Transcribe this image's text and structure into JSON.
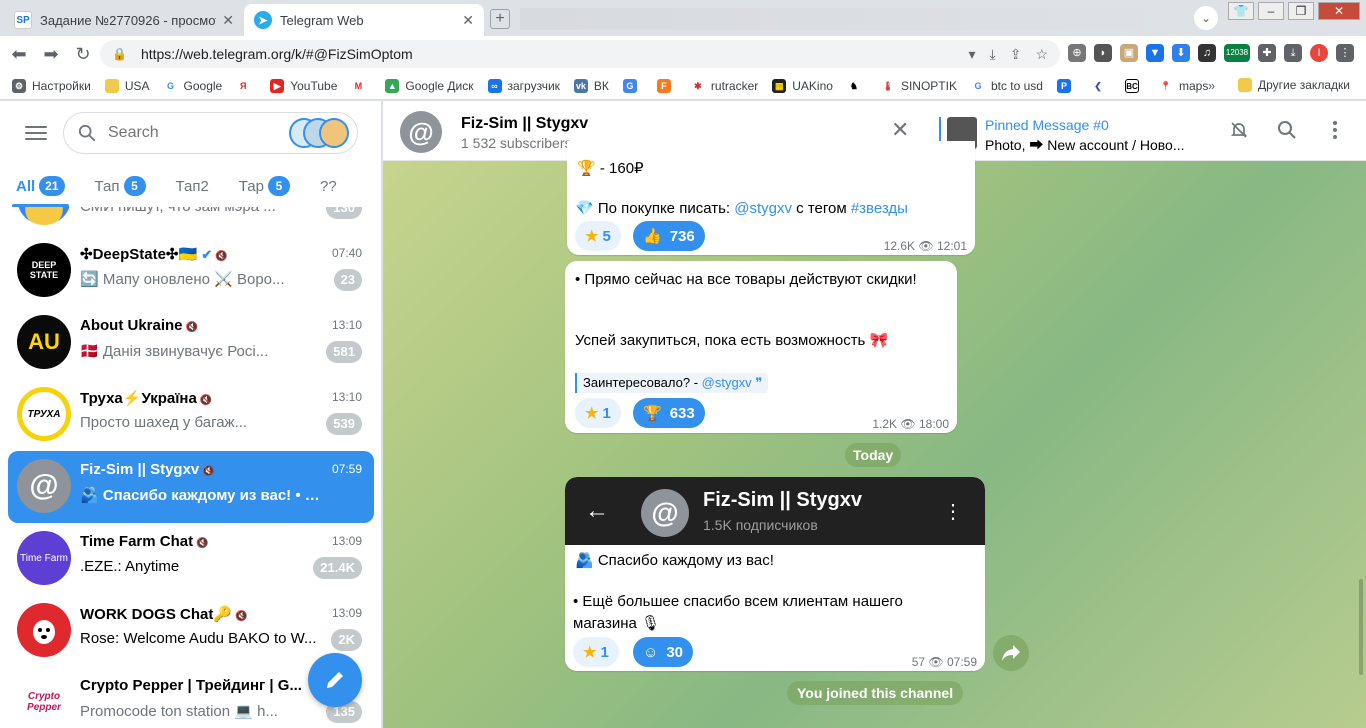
{
  "browser": {
    "tabs": [
      {
        "icon_text": "SP",
        "title": "Задание №2770926 - просмотр з"
      },
      {
        "icon_text": "",
        "title": "Telegram Web"
      }
    ],
    "url": "https://web.telegram.org/k/#@FizSimOptom",
    "ext_badge": "12038",
    "bookmarks": [
      "Настройки",
      "USA",
      "Google",
      "",
      "YouTube",
      "",
      "Google Диск",
      "загрузчик",
      "ВК",
      "",
      "",
      "rutracker",
      "UAKino",
      "",
      "SINOPTIK",
      "btc to usd",
      "",
      "",
      "",
      "maps"
    ],
    "bookmarks_more": "»",
    "other_bookmarks": "Другие закладки"
  },
  "sidebar": {
    "search_placeholder": "Search",
    "folders": [
      {
        "label": "All",
        "badge": "21"
      },
      {
        "label": "Тап",
        "badge": "5"
      },
      {
        "label": "Тап2",
        "badge": ""
      },
      {
        "label": "Тар",
        "badge": "5"
      },
      {
        "label": "??",
        "badge": ""
      }
    ],
    "partial_top_msg": "СМИ пишут, что зам мэра ...",
    "partial_top_badge": "130",
    "chats": [
      {
        "title": "✣DeepState✣🇺🇦",
        "time": "07:40",
        "msg": "🔄 Мапу оновлено ⚔️ Воро...",
        "badge": "23",
        "avatar": "DEEP STATE"
      },
      {
        "title": "About Ukraine",
        "time": "13:10",
        "msg": "🇩🇰 Данія звинувачує Росі...",
        "badge": "581",
        "avatar": "AU"
      },
      {
        "title": "Труха⚡Україна",
        "time": "13:10",
        "msg": "Просто шахед у багаж...",
        "badge": "539",
        "avatar": "ТРУХА"
      },
      {
        "title": "Fiz-Sim || Stygxv",
        "time": "07:59",
        "msg": "🫂 Спасибо каждому из вас! • Е...",
        "badge": "",
        "avatar": "@"
      },
      {
        "title": "Time Farm Chat",
        "time": "13:09",
        "msg": ".EZE.: Anytime",
        "badge": "21.4K",
        "avatar": "Time Farm"
      },
      {
        "title": "WORK DOGS Chat🔑",
        "time": "13:09",
        "msg": "Rose: Welcome Audu BAKO to W...",
        "badge": "2K",
        "avatar": ""
      },
      {
        "title": "Crypto Pepper | Трейдинг | G...",
        "time": "",
        "msg": "Promocode ton station 💻 h...",
        "badge": "135",
        "avatar": "Crypto Pepper"
      }
    ]
  },
  "chat": {
    "title": "Fiz-Sim || Stygxv",
    "subscribers": "1 532 subscribers",
    "pinned_title": "Pinned Message #0",
    "pinned_text": "Photo, ⮕ New account / Ново...",
    "msg1": {
      "top_line": "🏆 - 160₽",
      "line_prefix": "💎 По покупке писать: ",
      "line_handle": "@stygxv",
      "line_mid": " с тегом ",
      "line_tag": "#звезды",
      "star_count": "5",
      "reaction_count": "736",
      "views": "12.6K",
      "time": "12:01"
    },
    "msg2": {
      "line1": "• Прямо сейчас на все товары действуют скидки!",
      "line2": "Успей закупиться, пока есть возможность 🎀",
      "quote_prefix": "Заинтересовало? - ",
      "quote_handle": "@stygxv",
      "star_count": "1",
      "reaction_count": "633",
      "views": "1.2K",
      "time": "18:00"
    },
    "date_divider": "Today",
    "msg3": {
      "shot_title": "Fiz-Sim || Stygxv",
      "shot_sub": "1.5K подписчиков",
      "line1": "🫂 Спасибо каждому из вас!",
      "line2": "• Ещё большее спасибо всем клиентам нашего",
      "line3": "магазина 🎙",
      "star_count": "1",
      "reaction_count": "30",
      "views": "57",
      "time": "07:59"
    },
    "joined_notice": "You joined this channel"
  },
  "colors": {
    "accent": "#3390ec",
    "active_chat_bg": "#3390ec",
    "chat_bg": "#a7c582"
  }
}
